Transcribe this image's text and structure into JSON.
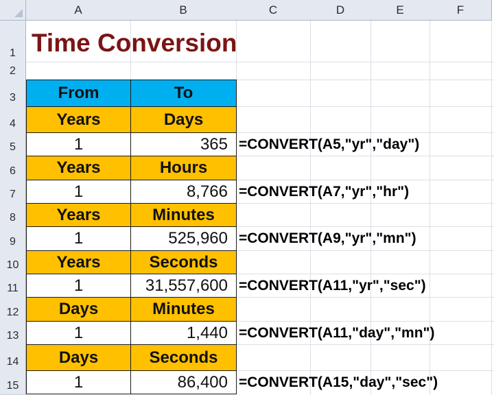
{
  "columns": [
    "A",
    "B",
    "C",
    "D",
    "E",
    "F"
  ],
  "rows": [
    "1",
    "2",
    "3",
    "4",
    "5",
    "6",
    "7",
    "8",
    "9",
    "10",
    "11",
    "12",
    "13",
    "14",
    "15"
  ],
  "title": "Time Conversion",
  "header": {
    "from": "From",
    "to": "To"
  },
  "blocks": [
    {
      "from_unit": "Years",
      "to_unit": "Days",
      "input": "1",
      "result": "365",
      "formula": "=CONVERT(A5,\"yr\",\"day\")"
    },
    {
      "from_unit": "Years",
      "to_unit": "Hours",
      "input": "1",
      "result": "8,766",
      "formula": "=CONVERT(A7,\"yr\",\"hr\")"
    },
    {
      "from_unit": "Years",
      "to_unit": "Minutes",
      "input": "1",
      "result": "525,960",
      "formula": "=CONVERT(A9,\"yr\",\"mn\")"
    },
    {
      "from_unit": "Years",
      "to_unit": "Seconds",
      "input": "1",
      "result": "31,557,600",
      "formula": "=CONVERT(A11,\"yr\",\"sec\")"
    },
    {
      "from_unit": "Days",
      "to_unit": "Minutes",
      "input": "1",
      "result": "1,440",
      "formula": "=CONVERT(A11,\"day\",\"mn\")"
    },
    {
      "from_unit": "Days",
      "to_unit": "Seconds",
      "input": "1",
      "result": "86,400",
      "formula": "=CONVERT(A15,\"day\",\"sec\")"
    }
  ],
  "colors": {
    "title": "#7b1414",
    "header_fill": "#00aff0",
    "unit_fill": "#ffc000"
  }
}
